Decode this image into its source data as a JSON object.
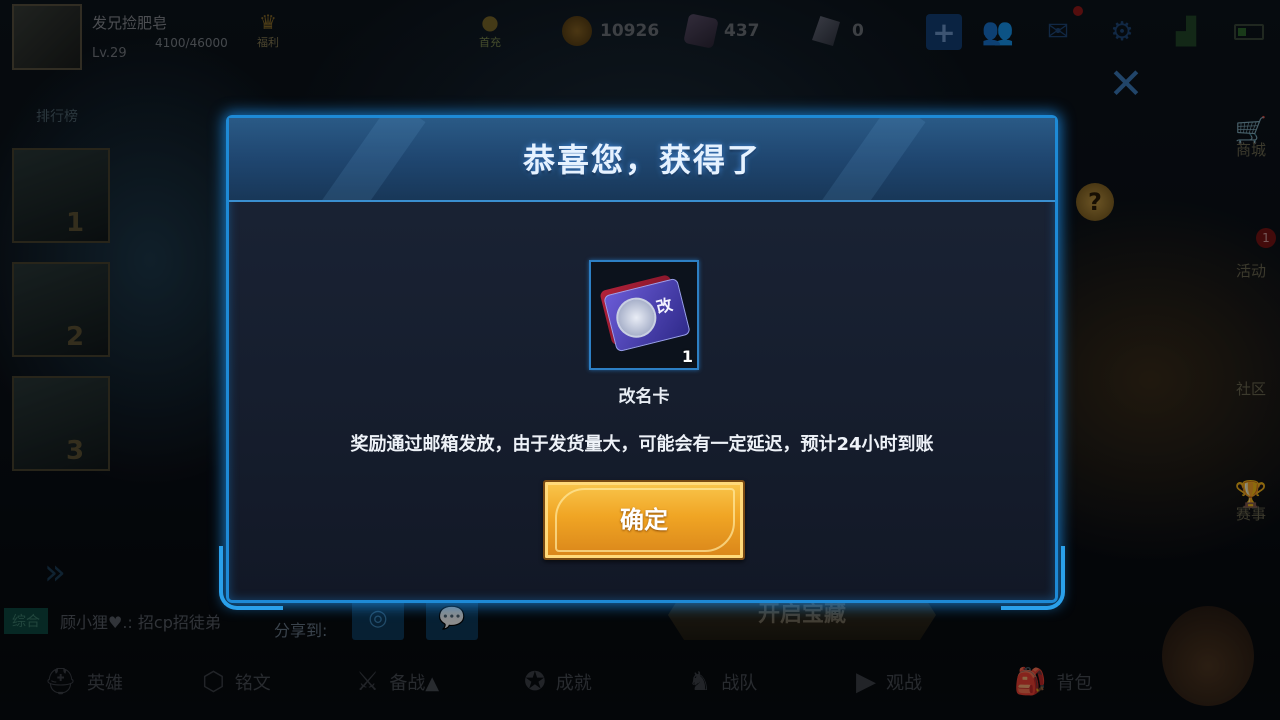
{
  "player": {
    "name": "发兄捡肥皂",
    "level": "Lv.29",
    "exp": "4100/46000"
  },
  "top_bar": {
    "welfare_label": "福利",
    "recharge_label": "首充",
    "gold": "10926",
    "diamond": "437",
    "crystal": "0"
  },
  "left_panel": {
    "leaderboard_title": "排行榜",
    "ranks": [
      "1",
      "2",
      "3"
    ]
  },
  "right_panel": {
    "shop": "商城",
    "activity": "活动",
    "activity_badge": "1",
    "community": "社区",
    "tournament": "赛事"
  },
  "chat": {
    "tag": "综合",
    "message": "顾小狸♥.: 招cp招徒弟"
  },
  "share": {
    "label": "分享到:"
  },
  "treasure_button": "开启宝藏",
  "bottom_nav": [
    {
      "label": "英雄"
    },
    {
      "label": "铭文"
    },
    {
      "label": "备战▲"
    },
    {
      "label": "成就"
    },
    {
      "label": "战队"
    },
    {
      "label": "观战"
    },
    {
      "label": "背包"
    }
  ],
  "modal": {
    "title": "恭喜您，获得了",
    "item": {
      "name": "改名卡",
      "count": "1",
      "card_char": "改"
    },
    "notice": "奖励通过邮箱发放，由于发货量大，可能会有一定延迟，预计24小时到账",
    "confirm_label": "确定"
  },
  "colors": {
    "modal_border": "#1e8ad6",
    "confirm_button": "#f0a524",
    "title_text": "#e6f2ff"
  }
}
